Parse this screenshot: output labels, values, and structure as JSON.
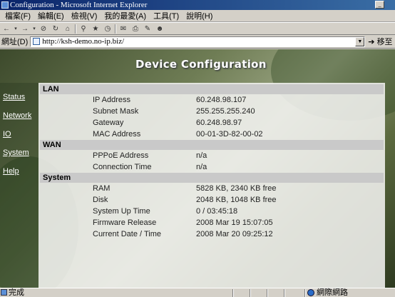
{
  "window": {
    "title": "Configuration - Microsoft Internet Explorer",
    "minimize_glyph": "_"
  },
  "menu": [
    "檔案(F)",
    "編輯(E)",
    "檢視(V)",
    "我的最愛(A)",
    "工具(T)",
    "說明(H)"
  ],
  "toolbar": {
    "icons": [
      "back-icon",
      "forward-icon",
      "stop-icon",
      "refresh-icon",
      "home-icon",
      "search-icon",
      "favorites-icon",
      "history-icon",
      "mail-icon",
      "print-icon",
      "edit-icon",
      "messenger-icon"
    ]
  },
  "address": {
    "label": "網址(D)",
    "url": "http://ksh-demo.no-ip.biz/",
    "go_label": "移至"
  },
  "page": {
    "title": "Device Configuration"
  },
  "nav": {
    "items": [
      {
        "label": "Status"
      },
      {
        "label": "Network"
      },
      {
        "label": "IO"
      },
      {
        "label": "System"
      },
      {
        "label": "Help"
      }
    ]
  },
  "sections": [
    {
      "name": "LAN",
      "rows": [
        {
          "label": "IP Address",
          "value": "60.248.98.107"
        },
        {
          "label": "Subnet Mask",
          "value": "255.255.255.240"
        },
        {
          "label": "Gateway",
          "value": "60.248.98.97"
        },
        {
          "label": "MAC Address",
          "value": "00-01-3D-82-00-02"
        }
      ]
    },
    {
      "name": "WAN",
      "rows": [
        {
          "label": "PPPoE Address",
          "value": "n/a"
        },
        {
          "label": "Connection Time",
          "value": "n/a"
        }
      ]
    },
    {
      "name": "System",
      "rows": [
        {
          "label": "RAM",
          "value": "5828 KB, 2340 KB free"
        },
        {
          "label": "Disk",
          "value": "2048 KB, 1048 KB free"
        },
        {
          "label": "System Up Time",
          "value": "0 / 03:45:18"
        },
        {
          "label": "Firmware Release",
          "value": "2008 Mar 19 15:07:05"
        },
        {
          "label": "Current Date / Time",
          "value": "2008 Mar 20 09:25:12"
        }
      ]
    }
  ],
  "status": {
    "text": "完成",
    "zone": "網際網路"
  }
}
